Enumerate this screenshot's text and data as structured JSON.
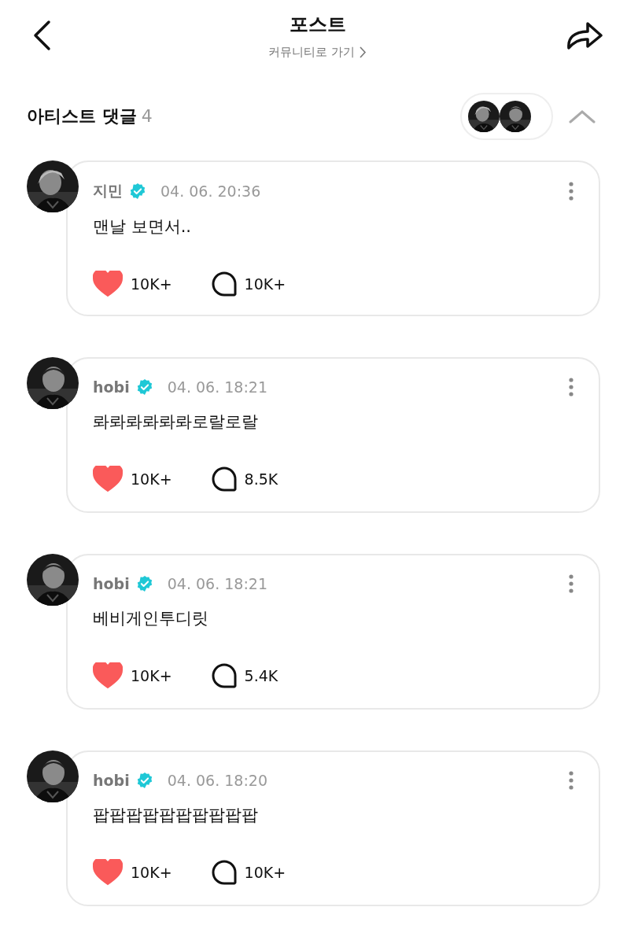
{
  "header": {
    "title": "포스트",
    "subtitle": "커뮤니티로 가기"
  },
  "section": {
    "title": "아티스트 댓글",
    "count": "4",
    "expanded": true
  },
  "comments": [
    {
      "author": "지민",
      "verified": true,
      "time": "04. 06. 20:36",
      "text": "맨날 보면서..",
      "liked": true,
      "likes": "10K+",
      "replies": "10K+"
    },
    {
      "author": "hobi",
      "verified": true,
      "time": "04. 06. 18:21",
      "text": "롸롸롸롸롸롸로랄로랄",
      "liked": true,
      "likes": "10K+",
      "replies": "8.5K"
    },
    {
      "author": "hobi",
      "verified": true,
      "time": "04. 06. 18:21",
      "text": "베비게인투디릿",
      "liked": true,
      "likes": "10K+",
      "replies": "5.4K"
    },
    {
      "author": "hobi",
      "verified": true,
      "time": "04. 06. 18:20",
      "text": "팝팝팝팝팝팝팝팝팝팝",
      "liked": true,
      "likes": "10K+",
      "replies": "10K+"
    }
  ]
}
